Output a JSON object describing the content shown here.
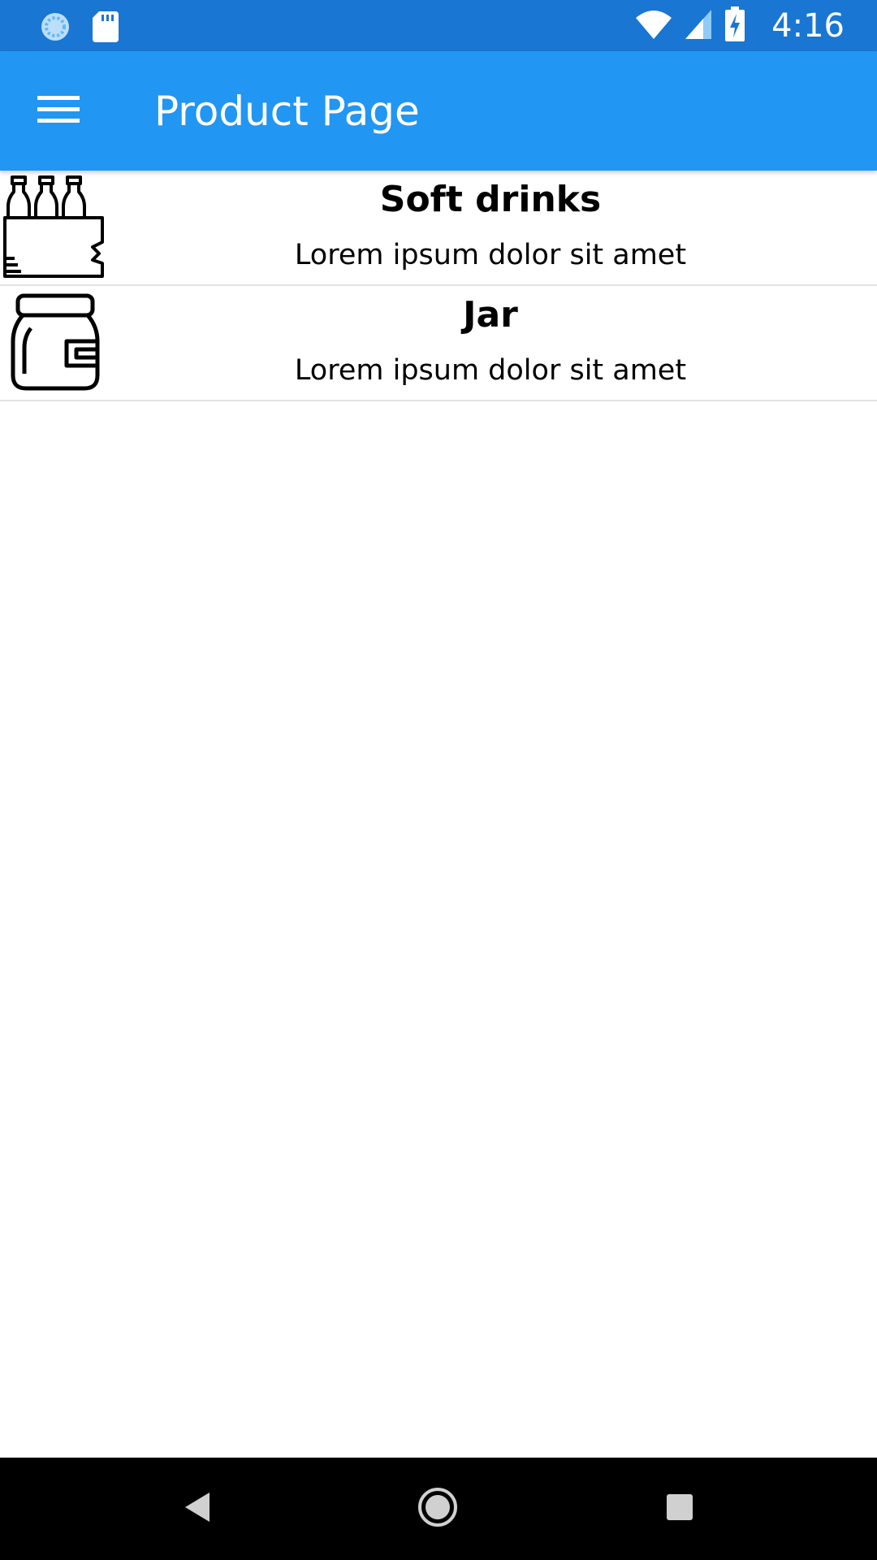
{
  "status_bar": {
    "time": "4:16",
    "icons": [
      "sync-icon",
      "sd-card-icon",
      "wifi-icon",
      "signal-icon",
      "battery-charging-icon"
    ]
  },
  "app_bar": {
    "title": "Product Page",
    "menu_icon": "hamburger-menu-icon",
    "background": "#2196F3"
  },
  "products": [
    {
      "icon": "bottles-pack-icon",
      "title": "Soft drinks",
      "description": "Lorem ipsum dolor sit amet"
    },
    {
      "icon": "jar-icon",
      "title": "Jar",
      "description": "Lorem ipsum dolor sit amet"
    }
  ],
  "nav_bar": {
    "icons": [
      "back-icon",
      "home-icon",
      "recents-icon"
    ]
  },
  "colors": {
    "status_bar": "#1976D2",
    "app_bar": "#2196F3",
    "divider": "#e3e3e3"
  }
}
